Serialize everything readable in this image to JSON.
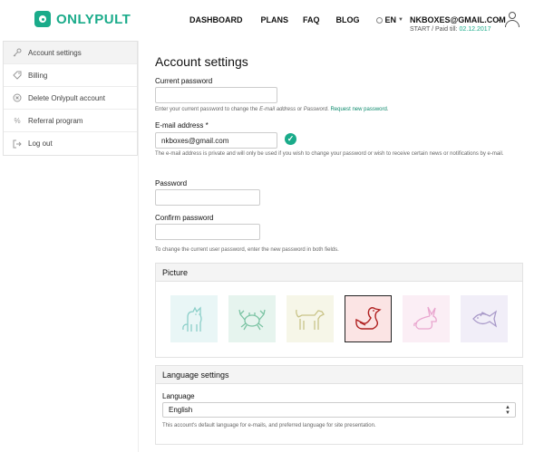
{
  "brand": {
    "name": "ONLYPULT"
  },
  "nav": {
    "dashboard": "DASHBOARD",
    "plans": "PLANS",
    "faq": "FAQ",
    "blog": "BLOG",
    "language": "EN"
  },
  "user": {
    "email": "NKBOXES@GMAIL.COM",
    "status_prefix": "START / Paid till:",
    "paid_till": "02.12.2017"
  },
  "sidebar": {
    "items": [
      {
        "label": "Account settings",
        "icon": "key-icon"
      },
      {
        "label": "Billing",
        "icon": "tag-icon"
      },
      {
        "label": "Delete Onlypult account",
        "icon": "close-circle-icon"
      },
      {
        "label": "Referral program",
        "icon": "percent-icon"
      },
      {
        "label": "Log out",
        "icon": "logout-icon"
      }
    ]
  },
  "main": {
    "title": "Account settings",
    "current_password": {
      "label": "Current password",
      "value": "",
      "hint_1": "Enter your current password to change the ",
      "hint_em1": "E-mail address",
      "hint_2": " or ",
      "hint_em2": "Password",
      "hint_3": ". ",
      "hint_link": "Request new password",
      "hint_4": "."
    },
    "email": {
      "label": "E-mail address *",
      "value": "nkboxes@gmail.com",
      "hint": "The e-mail address is private and will only be used if you wish to change your password or wish to receive certain news or notifications by e-mail."
    },
    "password": {
      "label": "Password",
      "value": ""
    },
    "confirm_password": {
      "label": "Confirm password",
      "value": "",
      "hint": "To change the current user password, enter the new password in both fields."
    },
    "picture": {
      "title": "Picture",
      "options": [
        "cat-icon",
        "crab-icon",
        "dog-icon",
        "duck-icon",
        "rabbit-icon",
        "fish-icon"
      ],
      "selected": "duck-icon"
    },
    "language_settings": {
      "title": "Language settings",
      "label": "Language",
      "value": "English",
      "hint": "This account's default language for e-mails, and preferred language for site presentation."
    }
  },
  "colors": {
    "accent": "#1aab8a",
    "selected_bg": "#fbe4e4"
  }
}
